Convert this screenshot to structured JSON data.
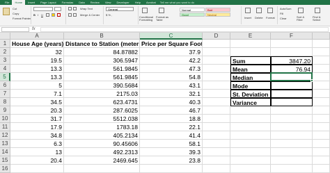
{
  "tabs": [
    {
      "label": "File",
      "active": false
    },
    {
      "label": "Home",
      "active": true
    },
    {
      "label": "Insert",
      "active": false
    },
    {
      "label": "Page Layout",
      "active": false
    },
    {
      "label": "Formulas",
      "active": false
    },
    {
      "label": "Data",
      "active": false
    },
    {
      "label": "Review",
      "active": false
    },
    {
      "label": "View",
      "active": false
    },
    {
      "label": "Developer",
      "active": false
    },
    {
      "label": "Help",
      "active": false
    },
    {
      "label": "Acrobat",
      "active": false
    }
  ],
  "tell_me": "Tell me what you want to do",
  "ribbon": {
    "cut": "Cut",
    "copy": "Copy",
    "format_painter": "Format Painter",
    "wrap_text": "Wrap Text",
    "merge_center": "Merge & Center",
    "number_format": "General",
    "conditional_formatting": "Conditional Formatting",
    "format_as_table": "Format as Table",
    "styles": {
      "normal": "Normal",
      "bad": "Bad",
      "good": "Good",
      "neutral": "Neutral"
    },
    "insert": "Insert",
    "delete": "Delete",
    "format": "Format",
    "autosum": "AutoSum",
    "fill": "Fill",
    "clear": "Clear",
    "sort_filter": "Sort & Filter",
    "find_select": "Find & Select"
  },
  "colors": {
    "excel_green": "#217346",
    "selected_header": "#d2e6d9"
  },
  "columns": [
    "A",
    "B",
    "C",
    "D",
    "E",
    "F"
  ],
  "rows": [
    "1",
    "2",
    "3",
    "4",
    "5",
    "6",
    "7",
    "8",
    "9",
    "10",
    "11",
    "12",
    "13",
    "14",
    "15",
    "16"
  ],
  "headers": {
    "a": "House Age (years)",
    "b": "Distance to Station (meters)",
    "c": "Price per Square Foot"
  },
  "data_rows": [
    {
      "a": "32",
      "b": "84.87882",
      "c": "37.9"
    },
    {
      "a": "19.5",
      "b": "306.5947",
      "c": "42.2"
    },
    {
      "a": "13.3",
      "b": "561.9845",
      "c": "47.3"
    },
    {
      "a": "13.3",
      "b": "561.9845",
      "c": "54.8"
    },
    {
      "a": "5",
      "b": "390.5684",
      "c": "43.1"
    },
    {
      "a": "7.1",
      "b": "2175.03",
      "c": "32.1"
    },
    {
      "a": "34.5",
      "b": "623.4731",
      "c": "40.3"
    },
    {
      "a": "20.3",
      "b": "287.6025",
      "c": "46.7"
    },
    {
      "a": "31.7",
      "b": "5512.038",
      "c": "18.8"
    },
    {
      "a": "17.9",
      "b": "1783.18",
      "c": "22.1"
    },
    {
      "a": "34.8",
      "b": "405.2134",
      "c": "41.4"
    },
    {
      "a": "6.3",
      "b": "90.45606",
      "c": "58.1"
    },
    {
      "a": "13",
      "b": "492.2313",
      "c": "39.3"
    },
    {
      "a": "20.4",
      "b": "2469.645",
      "c": "23.8"
    }
  ],
  "stats": [
    {
      "label": "Sum",
      "value": "3847.20"
    },
    {
      "label": "Mean",
      "value": "76.94"
    },
    {
      "label": "Median",
      "value": ""
    },
    {
      "label": "Mode",
      "value": ""
    },
    {
      "label": "St. Deviation",
      "value": ""
    },
    {
      "label": "Variance",
      "value": ""
    }
  ],
  "active_cell": "F5"
}
